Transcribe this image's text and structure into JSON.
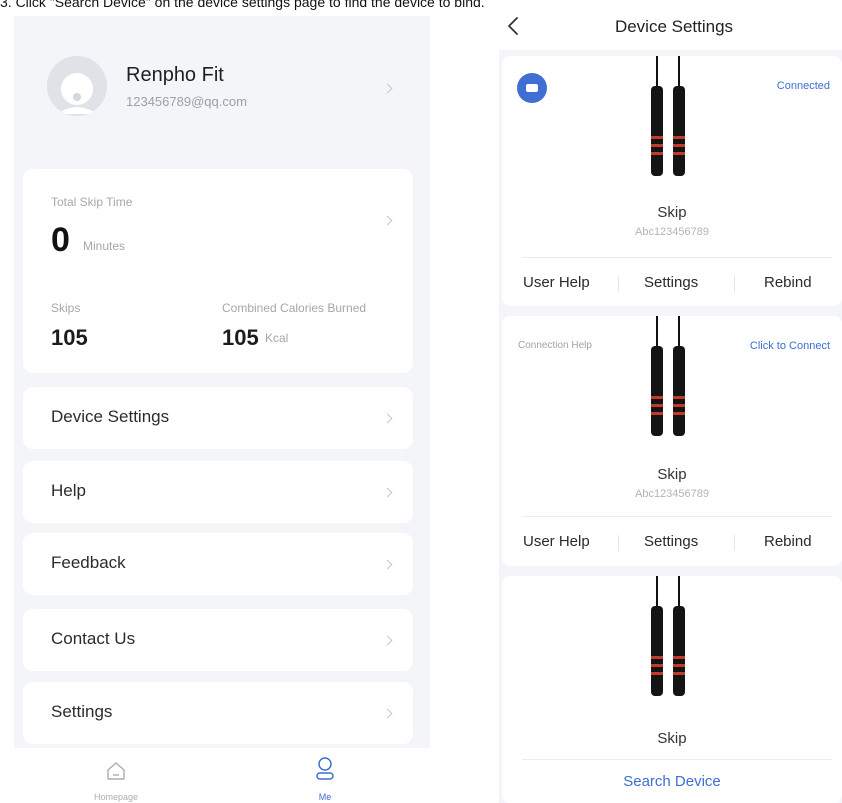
{
  "caption": "3. Click \"Search Device\" on the device settings page to find the device to bind.",
  "profile": {
    "name": "Renpho Fit",
    "email": "123456789@qq.com"
  },
  "stats": {
    "total_skip_time_label": "Total Skip Time",
    "total_skip_time_value": "0",
    "total_skip_time_unit": "Minutes",
    "skips_label": "Skips",
    "skips_value": "105",
    "calories_label": "Combined Calories Burned",
    "calories_value": "105",
    "calories_unit": "Kcal"
  },
  "menu": [
    {
      "label": "Device Settings"
    },
    {
      "label": "Help"
    },
    {
      "label": "Feedback"
    },
    {
      "label": "Contact Us"
    },
    {
      "label": "Settings"
    }
  ],
  "bottom_nav": {
    "home_label": "Homepage",
    "me_label": "Me",
    "active": "Me",
    "active_color": "#3d6fd0"
  },
  "device_settings": {
    "title": "Device Settings",
    "devices": [
      {
        "name": "Skip",
        "serial": "Abc123456789",
        "status": "Connected",
        "badge_icon": "bluetooth-connected-icon",
        "actions": [
          "User Help",
          "Settings",
          "Rebind"
        ]
      },
      {
        "name": "Skip",
        "serial": "Abc123456789",
        "status": "Click to Connect",
        "help_link": "Connection Help",
        "actions": [
          "User Help",
          "Settings",
          "Rebind"
        ]
      },
      {
        "name": "Skip",
        "search_label": "Search Device"
      }
    ]
  },
  "colors": {
    "accent": "#3d6fd0",
    "background": "#f4f5f8",
    "rope_stripe": "#c0392b"
  }
}
